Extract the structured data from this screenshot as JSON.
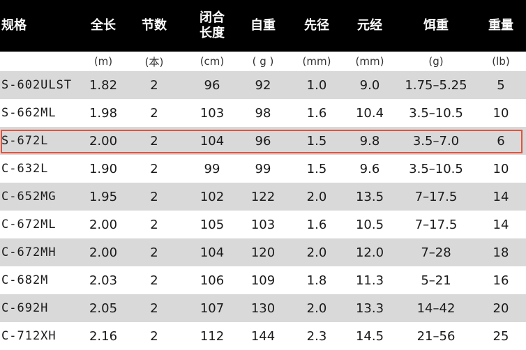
{
  "headers": {
    "model": "规格",
    "length": "全长",
    "sections": "节数",
    "closed_length_line1": "闭合",
    "closed_length_line2": "长度",
    "weight": "自重",
    "tip_diameter": "先径",
    "butt_diameter": "元经",
    "lure_weight": "饵重",
    "line_weight": "重量"
  },
  "units": [
    "(m)",
    "(本)",
    "(cm)",
    "( g )",
    "(mm)",
    "(mm)",
    "(g)",
    "(lb)"
  ],
  "rows": [
    {
      "model": "S-602ULST",
      "length": "1.82",
      "sections": "2",
      "closed": "96",
      "weight": "92",
      "tip": "1.0",
      "butt": "9.0",
      "lure": "1.75–5.25",
      "line": "5"
    },
    {
      "model": "S-662ML",
      "length": "1.98",
      "sections": "2",
      "closed": "103",
      "weight": "98",
      "tip": "1.6",
      "butt": "10.4",
      "lure": "3.5–10.5",
      "line": "10"
    },
    {
      "model": "S-672L",
      "length": "2.00",
      "sections": "2",
      "closed": "104",
      "weight": "96",
      "tip": "1.5",
      "butt": "9.8",
      "lure": "3.5–7.0",
      "line": "6"
    },
    {
      "model": "C-632L",
      "length": "1.90",
      "sections": "2",
      "closed": "99",
      "weight": "99",
      "tip": "1.5",
      "butt": "9.6",
      "lure": "3.5–10.5",
      "line": "10"
    },
    {
      "model": "C-652MG",
      "length": "1.95",
      "sections": "2",
      "closed": "102",
      "weight": "122",
      "tip": "2.0",
      "butt": "13.5",
      "lure": "7–17.5",
      "line": "14"
    },
    {
      "model": "C-672ML",
      "length": "2.00",
      "sections": "2",
      "closed": "105",
      "weight": "103",
      "tip": "1.6",
      "butt": "10.5",
      "lure": "7–17.5",
      "line": "14"
    },
    {
      "model": "C-672MH",
      "length": "2.00",
      "sections": "2",
      "closed": "104",
      "weight": "120",
      "tip": "2.0",
      "butt": "12.0",
      "lure": "7–28",
      "line": "18"
    },
    {
      "model": "C-682M",
      "length": "2.03",
      "sections": "2",
      "closed": "106",
      "weight": "109",
      "tip": "1.8",
      "butt": "11.3",
      "lure": "5–21",
      "line": "16"
    },
    {
      "model": "C-692H",
      "length": "2.05",
      "sections": "2",
      "closed": "107",
      "weight": "130",
      "tip": "2.0",
      "butt": "13.3",
      "lure": "14–42",
      "line": "20"
    },
    {
      "model": "C-712XH",
      "length": "2.16",
      "sections": "2",
      "closed": "112",
      "weight": "144",
      "tip": "2.3",
      "butt": "14.5",
      "lure": "21–56",
      "line": "25"
    }
  ],
  "highlighted_row_model": "S-672L",
  "colors": {
    "header_bg": "#000000",
    "header_text": "#ffffff",
    "stripe_gray": "#d9d9d9",
    "highlight_border": "#e8503a"
  }
}
